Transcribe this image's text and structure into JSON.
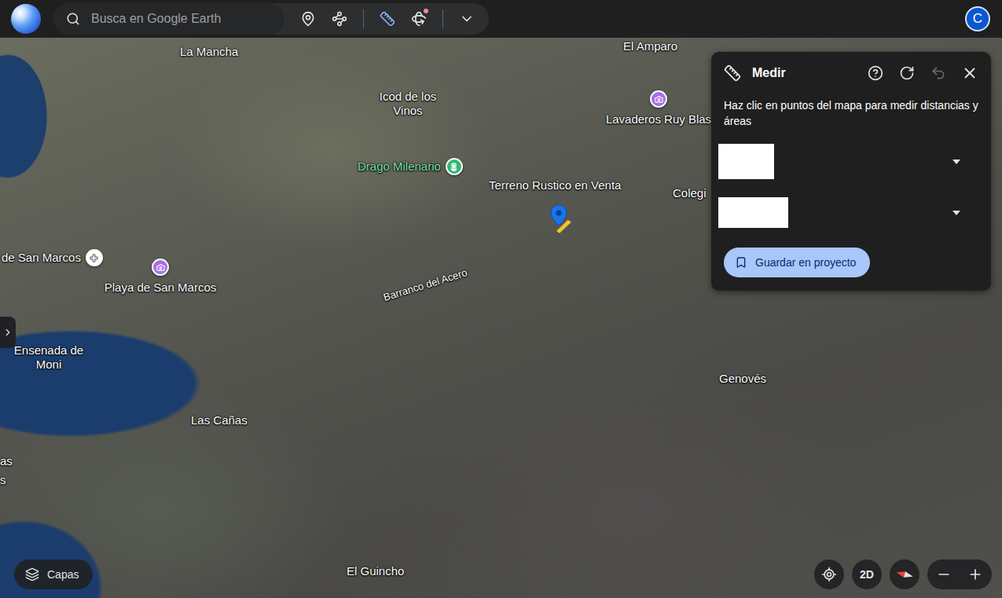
{
  "toolbar": {
    "search": {
      "placeholder": "Busca en Google Earth"
    },
    "tools": [
      {
        "selected": false,
        "badge": false
      },
      {
        "selected": false,
        "badge": false
      },
      {
        "selected": true,
        "badge": false
      },
      {
        "selected": false,
        "badge": true
      }
    ],
    "avatar": "C"
  },
  "map": {
    "labels": [
      {
        "text": "La Mancha",
        "kind": "place",
        "text_color": "#ffffff",
        "color": "#ffffff"
      },
      {
        "text": "Icod de los Vinos",
        "kind": "place",
        "text_color": "#ffffff",
        "color": "#ffffff"
      },
      {
        "text": "El Amparo",
        "kind": "place",
        "text_color": "#ffffff",
        "color": "#ffffff"
      },
      {
        "text": "Lavaderos Ruy Blas",
        "kind": "poi-top",
        "text_color": "#ffffff",
        "color": "#a86ee6"
      },
      {
        "text": "Drago Milenario",
        "kind": "poi-side",
        "text_color": "#7ee2a8",
        "color": "#2fb872"
      },
      {
        "text": "Terreno Rustico en Venta",
        "kind": "place",
        "text_color": "#ffffff",
        "color": "#ffffff"
      },
      {
        "text": "Colegi",
        "kind": "place",
        "text_color": "#ffffff",
        "color": "#ffffff"
      },
      {
        "text": "de San Marcos",
        "kind": "poi-side",
        "text_color": "#ffffff",
        "color": "#ffffff"
      },
      {
        "text": "Playa de San Marcos",
        "kind": "poi-top",
        "text_color": "#ffffff",
        "color": "#a86ee6"
      },
      {
        "text": "Barranco del Acero",
        "kind": "road",
        "text_color": "#ffffff",
        "color": "#ffffff"
      },
      {
        "text": "Ensenada de Moni",
        "kind": "place",
        "text_color": "#ffffff",
        "color": "#ffffff"
      },
      {
        "text": "Las Cañas",
        "kind": "place",
        "text_color": "#ffffff",
        "color": "#ffffff"
      },
      {
        "text": "Genovés",
        "kind": "place",
        "text_color": "#ffffff",
        "color": "#ffffff"
      },
      {
        "text": "El Guincho",
        "kind": "place",
        "text_color": "#ffffff",
        "color": "#ffffff"
      },
      {
        "text": "as",
        "kind": "place",
        "text_color": "#ffffff",
        "color": "#ffffff"
      },
      {
        "text": "s",
        "kind": "place",
        "text_color": "#ffffff",
        "color": "#ffffff"
      }
    ]
  },
  "measure_panel": {
    "title": "Medir",
    "actions": [
      {
        "disabled": false
      },
      {
        "disabled": false
      },
      {
        "disabled": true
      },
      {
        "disabled": false
      }
    ],
    "description": "Haz clic en puntos del mapa para medir distancias y áreas",
    "fields": [
      {
        "expanded": false
      },
      {
        "expanded": false
      }
    ],
    "button": "Guardar en proyecto"
  },
  "controls": {
    "layers": "Capas",
    "view_mode": "2D"
  }
}
